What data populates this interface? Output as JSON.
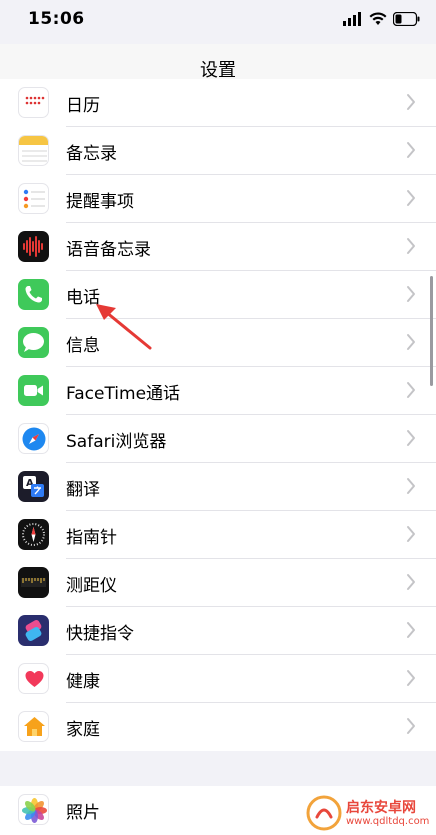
{
  "status": {
    "time": "15:06"
  },
  "nav": {
    "title": "设置"
  },
  "rows": [
    {
      "label": "日历",
      "icon": "calendar-icon"
    },
    {
      "label": "备忘录",
      "icon": "notes-icon"
    },
    {
      "label": "提醒事项",
      "icon": "reminders-icon"
    },
    {
      "label": "语音备忘录",
      "icon": "voice-memos-icon"
    },
    {
      "label": "电话",
      "icon": "phone-icon"
    },
    {
      "label": "信息",
      "icon": "messages-icon"
    },
    {
      "label": "FaceTime通话",
      "icon": "facetime-icon"
    },
    {
      "label": "Safari浏览器",
      "icon": "safari-icon"
    },
    {
      "label": "翻译",
      "icon": "translate-icon"
    },
    {
      "label": "指南针",
      "icon": "compass-icon"
    },
    {
      "label": "测距仪",
      "icon": "measure-icon"
    },
    {
      "label": "快捷指令",
      "icon": "shortcuts-icon"
    },
    {
      "label": "健康",
      "icon": "health-icon"
    },
    {
      "label": "家庭",
      "icon": "home-icon"
    }
  ],
  "group2": [
    {
      "label": "照片",
      "icon": "photos-icon"
    }
  ],
  "watermark": {
    "text": "启东安卓网",
    "url": "www.qdltdq.com"
  }
}
